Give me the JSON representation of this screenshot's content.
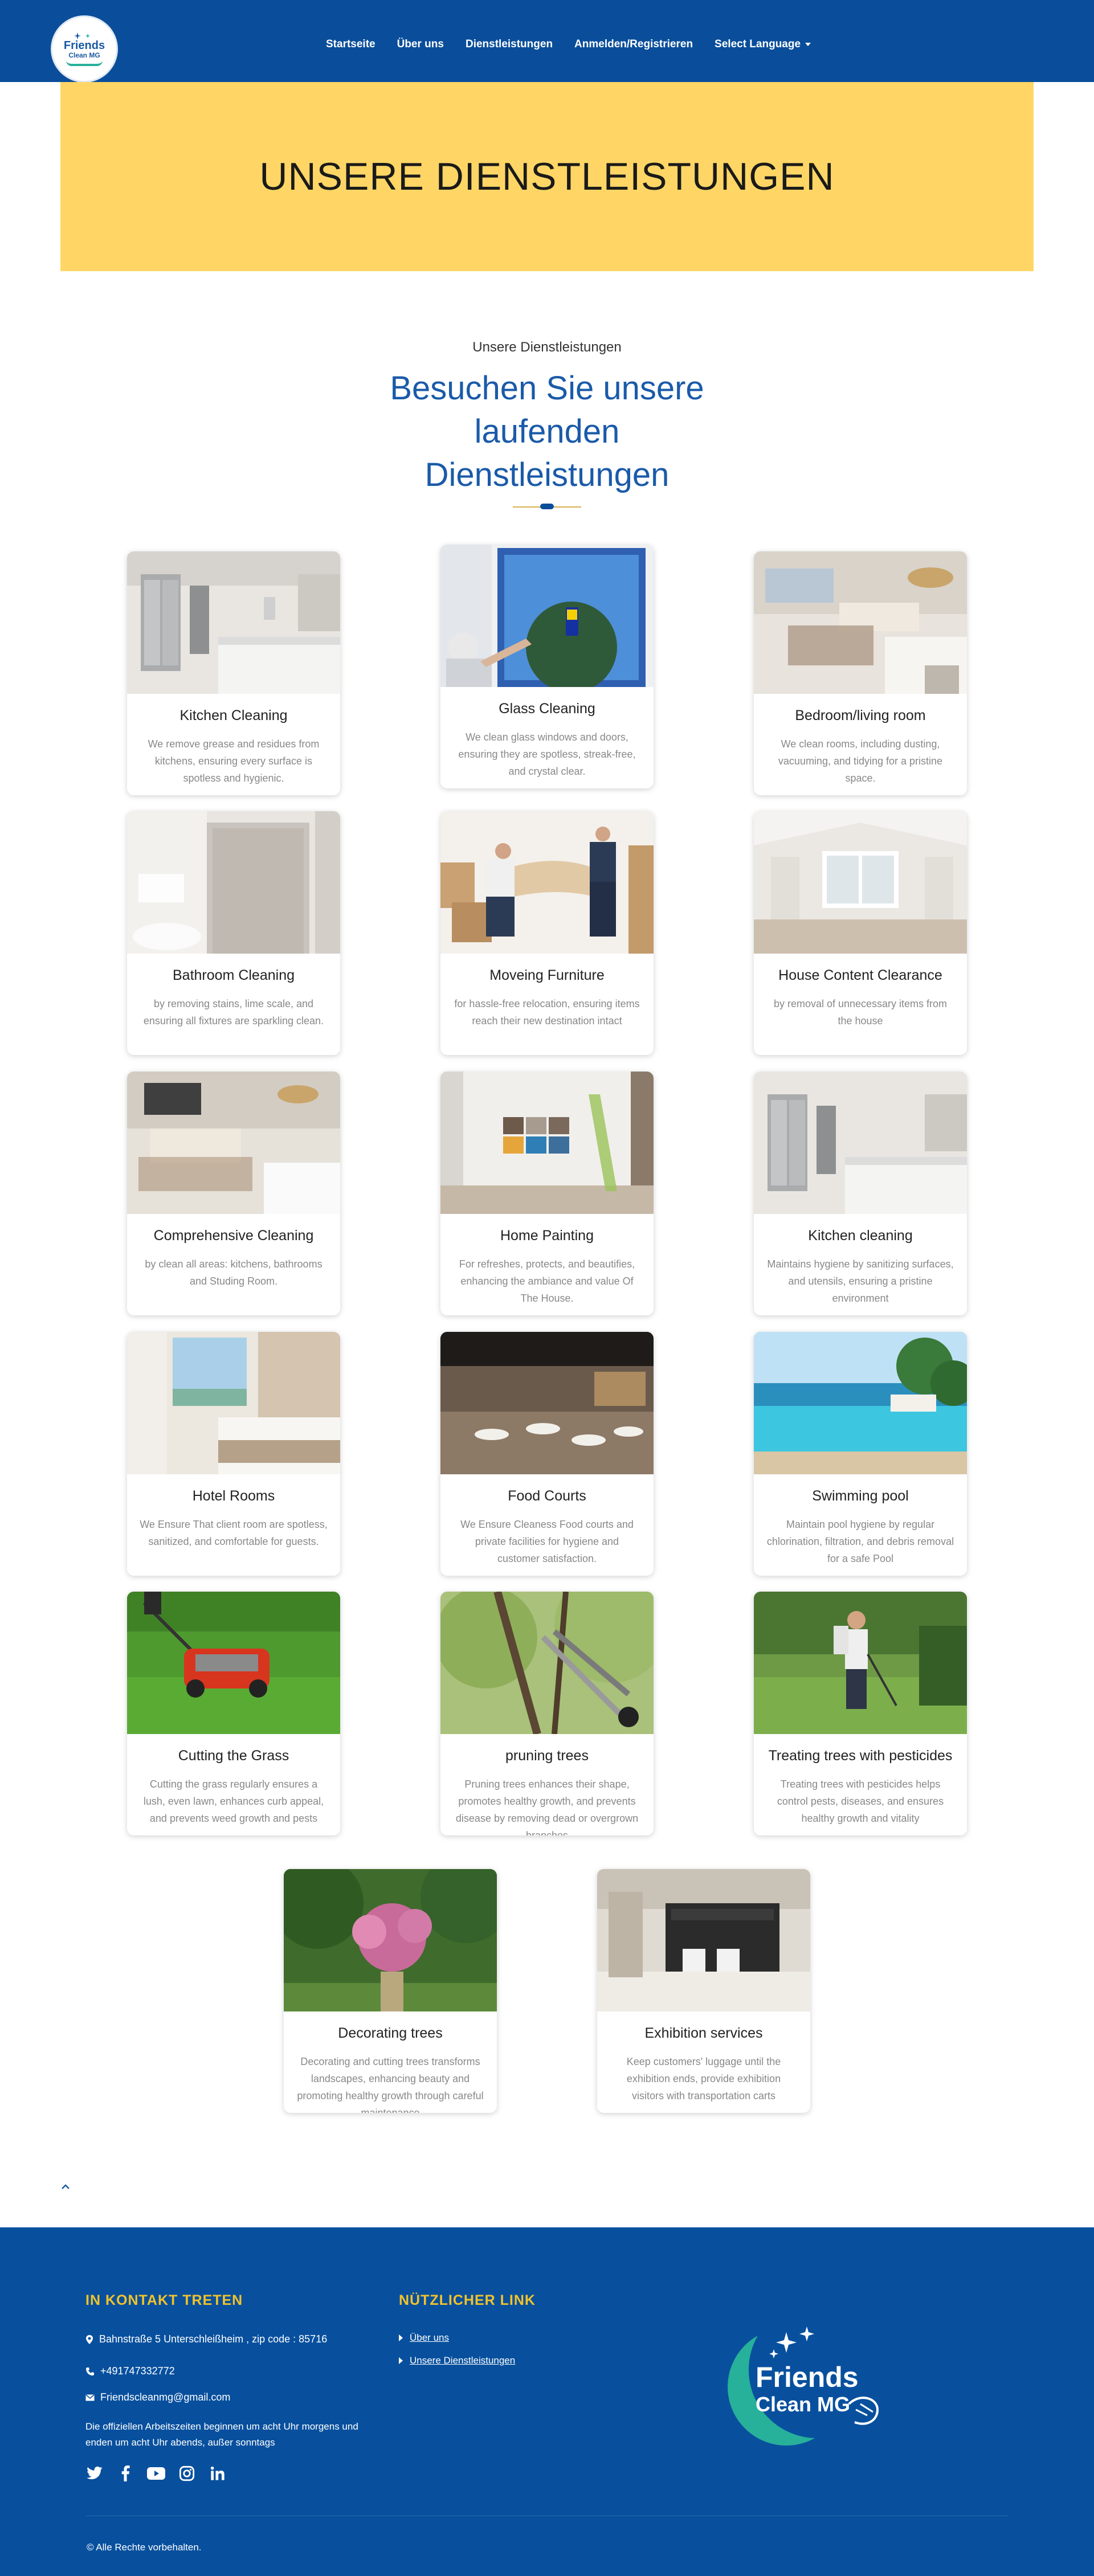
{
  "nav": {
    "logo": {
      "name": "Friends",
      "sub": "Clean MG"
    },
    "links": [
      "Startseite",
      "Über uns",
      "Dienstleistungen",
      "Anmelden/Registrieren",
      "Select Language"
    ]
  },
  "hero": {
    "title": "UNSERE DIENSTLEISTUNGEN"
  },
  "section": {
    "subtitle": "Unsere Dienstleistungen",
    "title": "Besuchen Sie unsere laufenden Dienstleistungen"
  },
  "services": [
    {
      "title": "Kitchen Cleaning",
      "text": "We remove grease and residues from kitchens, ensuring every surface is spotless and hygienic."
    },
    {
      "title": "Glass Cleaning",
      "text": "We clean glass windows and doors, ensuring they are spotless, streak-free, and crystal clear."
    },
    {
      "title": "Bedroom/living room",
      "text": "We clean rooms, including dusting, vacuuming, and tidying for a pristine space."
    },
    {
      "title": "Bathroom Cleaning",
      "text": "by removing stains, lime scale, and ensuring all fixtures are sparkling clean."
    },
    {
      "title": "Moveing Furniture",
      "text": "for hassle-free relocation, ensuring items reach their new destination intact"
    },
    {
      "title": "House Content Clearance",
      "text": "by removal of unnecessary items from the house"
    },
    {
      "title": "Comprehensive Cleaning",
      "text": "by clean all areas: kitchens, bathrooms and Studing Room."
    },
    {
      "title": "Home Painting",
      "text": "For refreshes, protects, and beautifies, enhancing the ambiance and value Of The House."
    },
    {
      "title": "Kitchen cleaning",
      "text": "Maintains hygiene by sanitizing surfaces, and utensils, ensuring a pristine environment"
    },
    {
      "title": "Hotel Rooms",
      "text": "We Ensure That client room are spotless, sanitized, and comfortable for guests."
    },
    {
      "title": "Food Courts",
      "text": "We Ensure Cleaness Food courts and private facilities for hygiene and customer satisfaction."
    },
    {
      "title": "Swimming pool",
      "text": "Maintain pool hygiene by regular chlorination, filtration, and debris removal for a safe Pool"
    },
    {
      "title": "Cutting the Grass",
      "text": "Cutting the grass regularly ensures a lush, even lawn, enhances curb appeal, and prevents weed growth and pests"
    },
    {
      "title": "pruning trees",
      "text": "Pruning trees enhances their shape, promotes healthy growth, and prevents disease by removing dead or overgrown branches"
    },
    {
      "title": "Treating trees with pesticides",
      "text": "Treating trees with pesticides helps control pests, diseases, and ensures healthy growth and vitality"
    },
    {
      "title": "Decorating trees",
      "text": "Decorating and cutting trees transforms landscapes, enhancing beauty and promoting healthy growth through careful maintenance"
    },
    {
      "title": "Exhibition services",
      "text": "Keep customers' luggage until the exhibition ends, provide exhibition visitors with transportation carts"
    }
  ],
  "footer": {
    "contact_heading": "IN KONTAKT TRETEN",
    "address": "Bahnstraße 5 Unterschleißheim , zip code : 85716",
    "phone": "+491747332772",
    "email": "Friendscleanmg@gmail.com",
    "hours": "Die offiziellen Arbeitszeiten beginnen um acht Uhr morgens und enden um acht Uhr abends, außer sonntags",
    "links_heading": "NÜTZLICHER LINK",
    "links": [
      "Über uns",
      "Unsere Dienstleistungen"
    ],
    "logo": {
      "name": "Friends",
      "sub": "Clean MG"
    },
    "copyright": "© Alle Rechte vorbehalten."
  },
  "colors": {
    "navy": "#0a4e9b",
    "banner": "#ffd665",
    "title_blue": "#1a5aa9",
    "footer_heading": "#f2c22a"
  }
}
